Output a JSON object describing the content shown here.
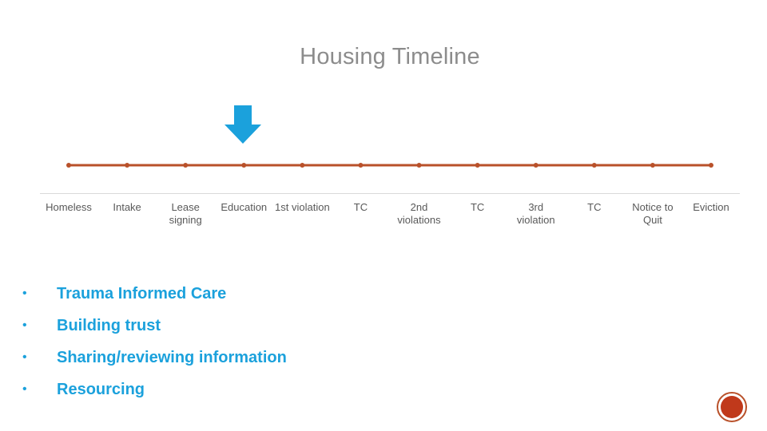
{
  "slide": {
    "title": "Housing Timeline",
    "colors": {
      "title": "#8c8c8c",
      "timeline_line": "#b9512a",
      "arrow": "#1ba1dc",
      "bullets": "#1ba1dc",
      "labels": "#595959",
      "divider": "#d9d9d9",
      "badge": "#c0391b"
    },
    "current_stage_marker": {
      "icon": "down-arrow-icon",
      "points_to_stage": "Education"
    },
    "timeline": {
      "stages": [
        {
          "label": "Homeless"
        },
        {
          "label": "Intake"
        },
        {
          "label": "Lease signing"
        },
        {
          "label": "Education"
        },
        {
          "label": "1st violation"
        },
        {
          "label": "TC"
        },
        {
          "label": "2nd violations"
        },
        {
          "label": "TC"
        },
        {
          "label": "3rd violation"
        },
        {
          "label": "TC"
        },
        {
          "label": "Notice to Quit"
        },
        {
          "label": "Eviction"
        }
      ]
    },
    "bullets": [
      {
        "bullet": "•",
        "text": "Trauma Informed Care"
      },
      {
        "bullet": "•",
        "text": "Building trust"
      },
      {
        "bullet": "•",
        "text": "Sharing/reviewing information"
      },
      {
        "bullet": "•",
        "text": "Resourcing"
      }
    ],
    "badge": {
      "icon": "slide-badge-icon"
    }
  }
}
